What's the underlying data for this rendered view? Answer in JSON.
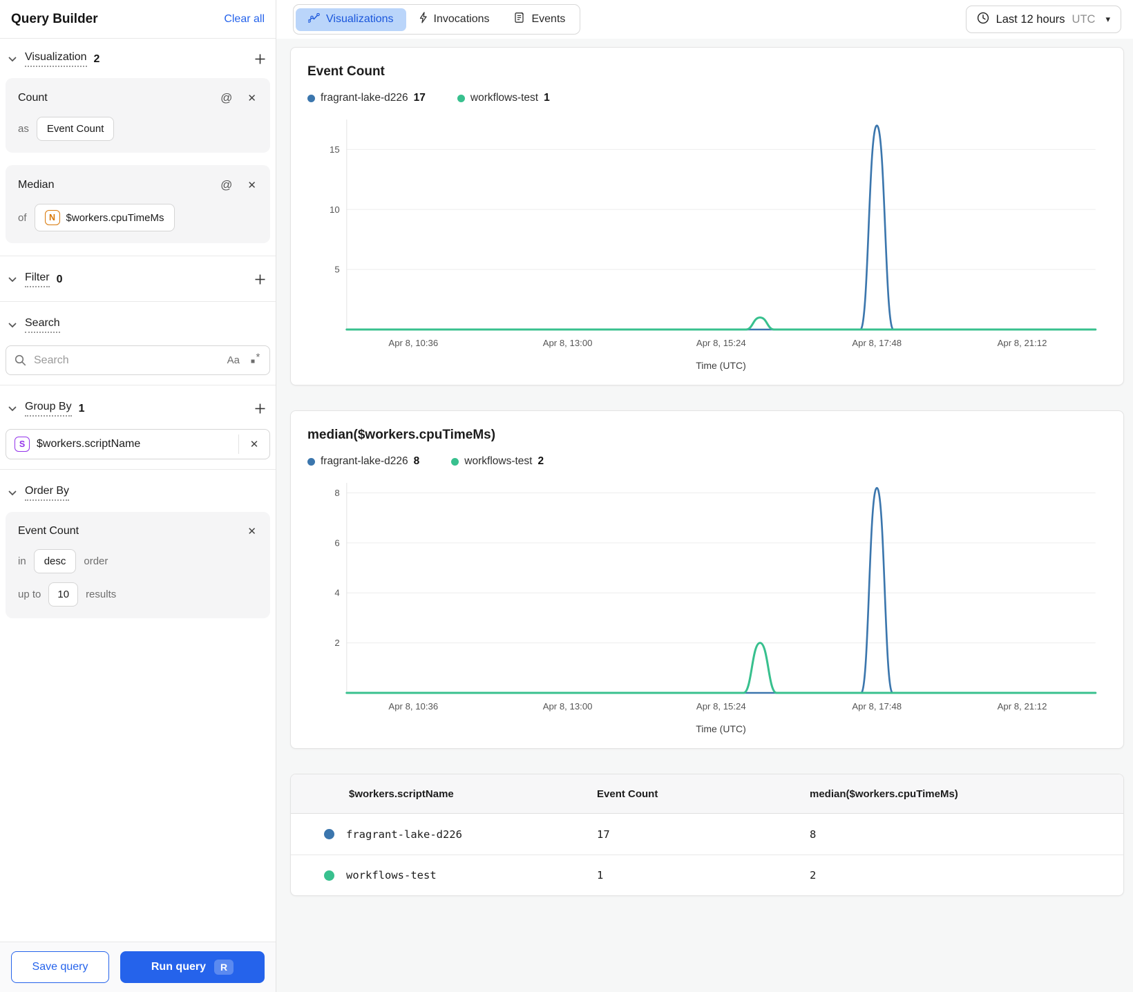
{
  "icons": {
    "at": "@",
    "close": "✕",
    "caret_down": "▾",
    "match_case": "Aa"
  },
  "colors": {
    "series_blue": "#3B76AD",
    "series_green": "#38C08E",
    "accent_blue": "#2563EB",
    "tab_active_bg": "#BAD5FA",
    "tab_active_text": "#1A56DB"
  },
  "sidebar": {
    "title": "Query Builder",
    "clear_all": "Clear all",
    "visualization": {
      "label": "Visualization",
      "count": "2"
    },
    "visualizations": [
      {
        "name": "Count",
        "prefix": "as",
        "value": "Event Count"
      },
      {
        "name": "Median",
        "prefix": "of",
        "badge": "N",
        "value": "$workers.cpuTimeMs"
      }
    ],
    "filter": {
      "label": "Filter",
      "count": "0"
    },
    "search": {
      "label": "Search",
      "placeholder": "Search"
    },
    "group_by": {
      "label": "Group By",
      "count": "1",
      "badge": "S",
      "value": "$workers.scriptName"
    },
    "order_by": {
      "label": "Order By",
      "name": "Event Count",
      "in_label": "in",
      "direction": "desc",
      "order_label": "order",
      "up_to_label": "up to",
      "limit": "10",
      "results_label": "results"
    },
    "footer": {
      "save": "Save query",
      "run": "Run query",
      "run_shortcut": "R"
    }
  },
  "topbar": {
    "tabs": [
      {
        "label": "Visualizations",
        "active": true
      },
      {
        "label": "Invocations",
        "active": false
      },
      {
        "label": "Events",
        "active": false
      }
    ],
    "time_range": {
      "label": "Last 12 hours",
      "timezone": "UTC"
    }
  },
  "chart_data": [
    {
      "type": "line",
      "title": "Event Count",
      "xlabel": "Time (UTC)",
      "x_ticks": [
        "Apr 8, 10:36",
        "Apr 8, 13:00",
        "Apr 8, 15:24",
        "Apr 8, 17:48",
        "Apr 8, 21:12"
      ],
      "x_tick_pos": [
        0.089,
        0.295,
        0.5,
        0.708,
        0.902
      ],
      "y_ticks": [
        5,
        10,
        15
      ],
      "ylim": [
        0,
        17.5
      ],
      "grid": true,
      "legend_position": "top",
      "legend": [
        {
          "name": "fragrant-lake-d226",
          "total": 17,
          "color": "#3B76AD"
        },
        {
          "name": "workflows-test",
          "total": 1,
          "color": "#38C08E"
        }
      ],
      "series": [
        {
          "name": "fragrant-lake-d226",
          "color": "#3B76AD",
          "width": 2.6,
          "points": [
            [
              0,
              0
            ],
            [
              0.686,
              0
            ],
            [
              0.708,
              17
            ],
            [
              0.73,
              0
            ],
            [
              1,
              0
            ]
          ]
        },
        {
          "name": "workflows-test",
          "color": "#38C08E",
          "width": 3,
          "points": [
            [
              0,
              0
            ],
            [
              0.533,
              0
            ],
            [
              0.552,
              1
            ],
            [
              0.571,
              0
            ],
            [
              1,
              0
            ]
          ]
        }
      ]
    },
    {
      "type": "line",
      "title": "median($workers.cpuTimeMs)",
      "xlabel": "Time (UTC)",
      "x_ticks": [
        "Apr 8, 10:36",
        "Apr 8, 13:00",
        "Apr 8, 15:24",
        "Apr 8, 17:48",
        "Apr 8, 21:12"
      ],
      "x_tick_pos": [
        0.089,
        0.295,
        0.5,
        0.708,
        0.902
      ],
      "y_ticks": [
        2,
        4,
        6,
        8
      ],
      "ylim": [
        0,
        8.4
      ],
      "grid": true,
      "legend_position": "top",
      "legend": [
        {
          "name": "fragrant-lake-d226",
          "total": 8,
          "color": "#3B76AD"
        },
        {
          "name": "workflows-test",
          "total": 2,
          "color": "#38C08E"
        }
      ],
      "series": [
        {
          "name": "fragrant-lake-d226",
          "color": "#3B76AD",
          "width": 2.6,
          "points": [
            [
              0,
              0
            ],
            [
              0.687,
              0
            ],
            [
              0.708,
              8.2
            ],
            [
              0.729,
              0
            ],
            [
              1,
              0
            ]
          ]
        },
        {
          "name": "workflows-test",
          "color": "#38C08E",
          "width": 3,
          "points": [
            [
              0,
              0
            ],
            [
              0.53,
              0
            ],
            [
              0.552,
              2
            ],
            [
              0.574,
              0
            ],
            [
              1,
              0
            ]
          ]
        }
      ]
    },
    {
      "type": "table",
      "columns": [
        "$workers.scriptName",
        "Event Count",
        "median($workers.cpuTimeMs)"
      ],
      "rows": [
        {
          "color": "#3B76AD",
          "cells": [
            "fragrant-lake-d226",
            "17",
            "8"
          ]
        },
        {
          "color": "#38C08E",
          "cells": [
            "workflows-test",
            "1",
            "2"
          ]
        }
      ]
    }
  ]
}
